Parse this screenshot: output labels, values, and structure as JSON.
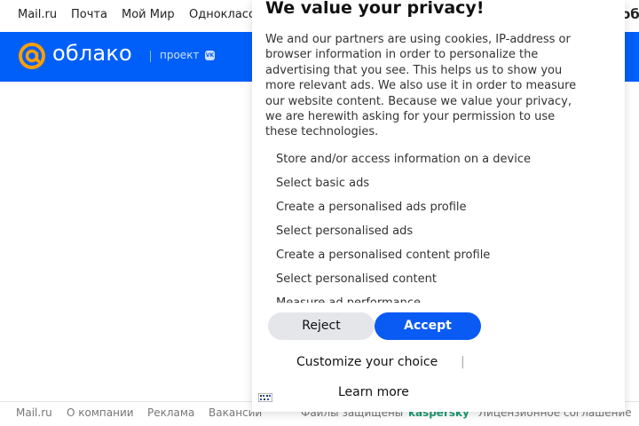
{
  "top_nav": {
    "items": [
      "Mail.ru",
      "Почта",
      "Мой Мир",
      "Одноклассники"
    ],
    "overflow_text": "об"
  },
  "brand": {
    "name": "облако",
    "project_label": "проект",
    "vk_badge": "VK",
    "color": "#005ff9",
    "accent_color": "#ff9e00"
  },
  "footer": {
    "links": [
      "Mail.ru",
      "О компании",
      "Реклама",
      "Вакансии"
    ],
    "protected_text": "Файлы защищены",
    "protected_brand": "kaspersky",
    "license_text": "Лицензионное соглашение"
  },
  "privacy_modal": {
    "title": "We value your privacy!",
    "body": "We and our partners are using cookies, IP-address or browser information in order to personalize the advertising that you see. This helps us to show you more relevant ads. We also use it in order to measure our website content. Because we value your privacy, we are herewith asking for your permission to use these technologies.",
    "purposes": [
      "Store and/or access information on a device",
      "Select basic ads",
      "Create a personalised ads profile",
      "Select personalised ads",
      "Create a personalised content profile",
      "Select personalised content",
      "Measure ad performance"
    ],
    "reject_label": "Reject",
    "accept_label": "Accept",
    "customize_label": "Customize your choice",
    "separator": "|",
    "learn_more_label": "Learn more",
    "accept_color": "#0a5af4"
  }
}
